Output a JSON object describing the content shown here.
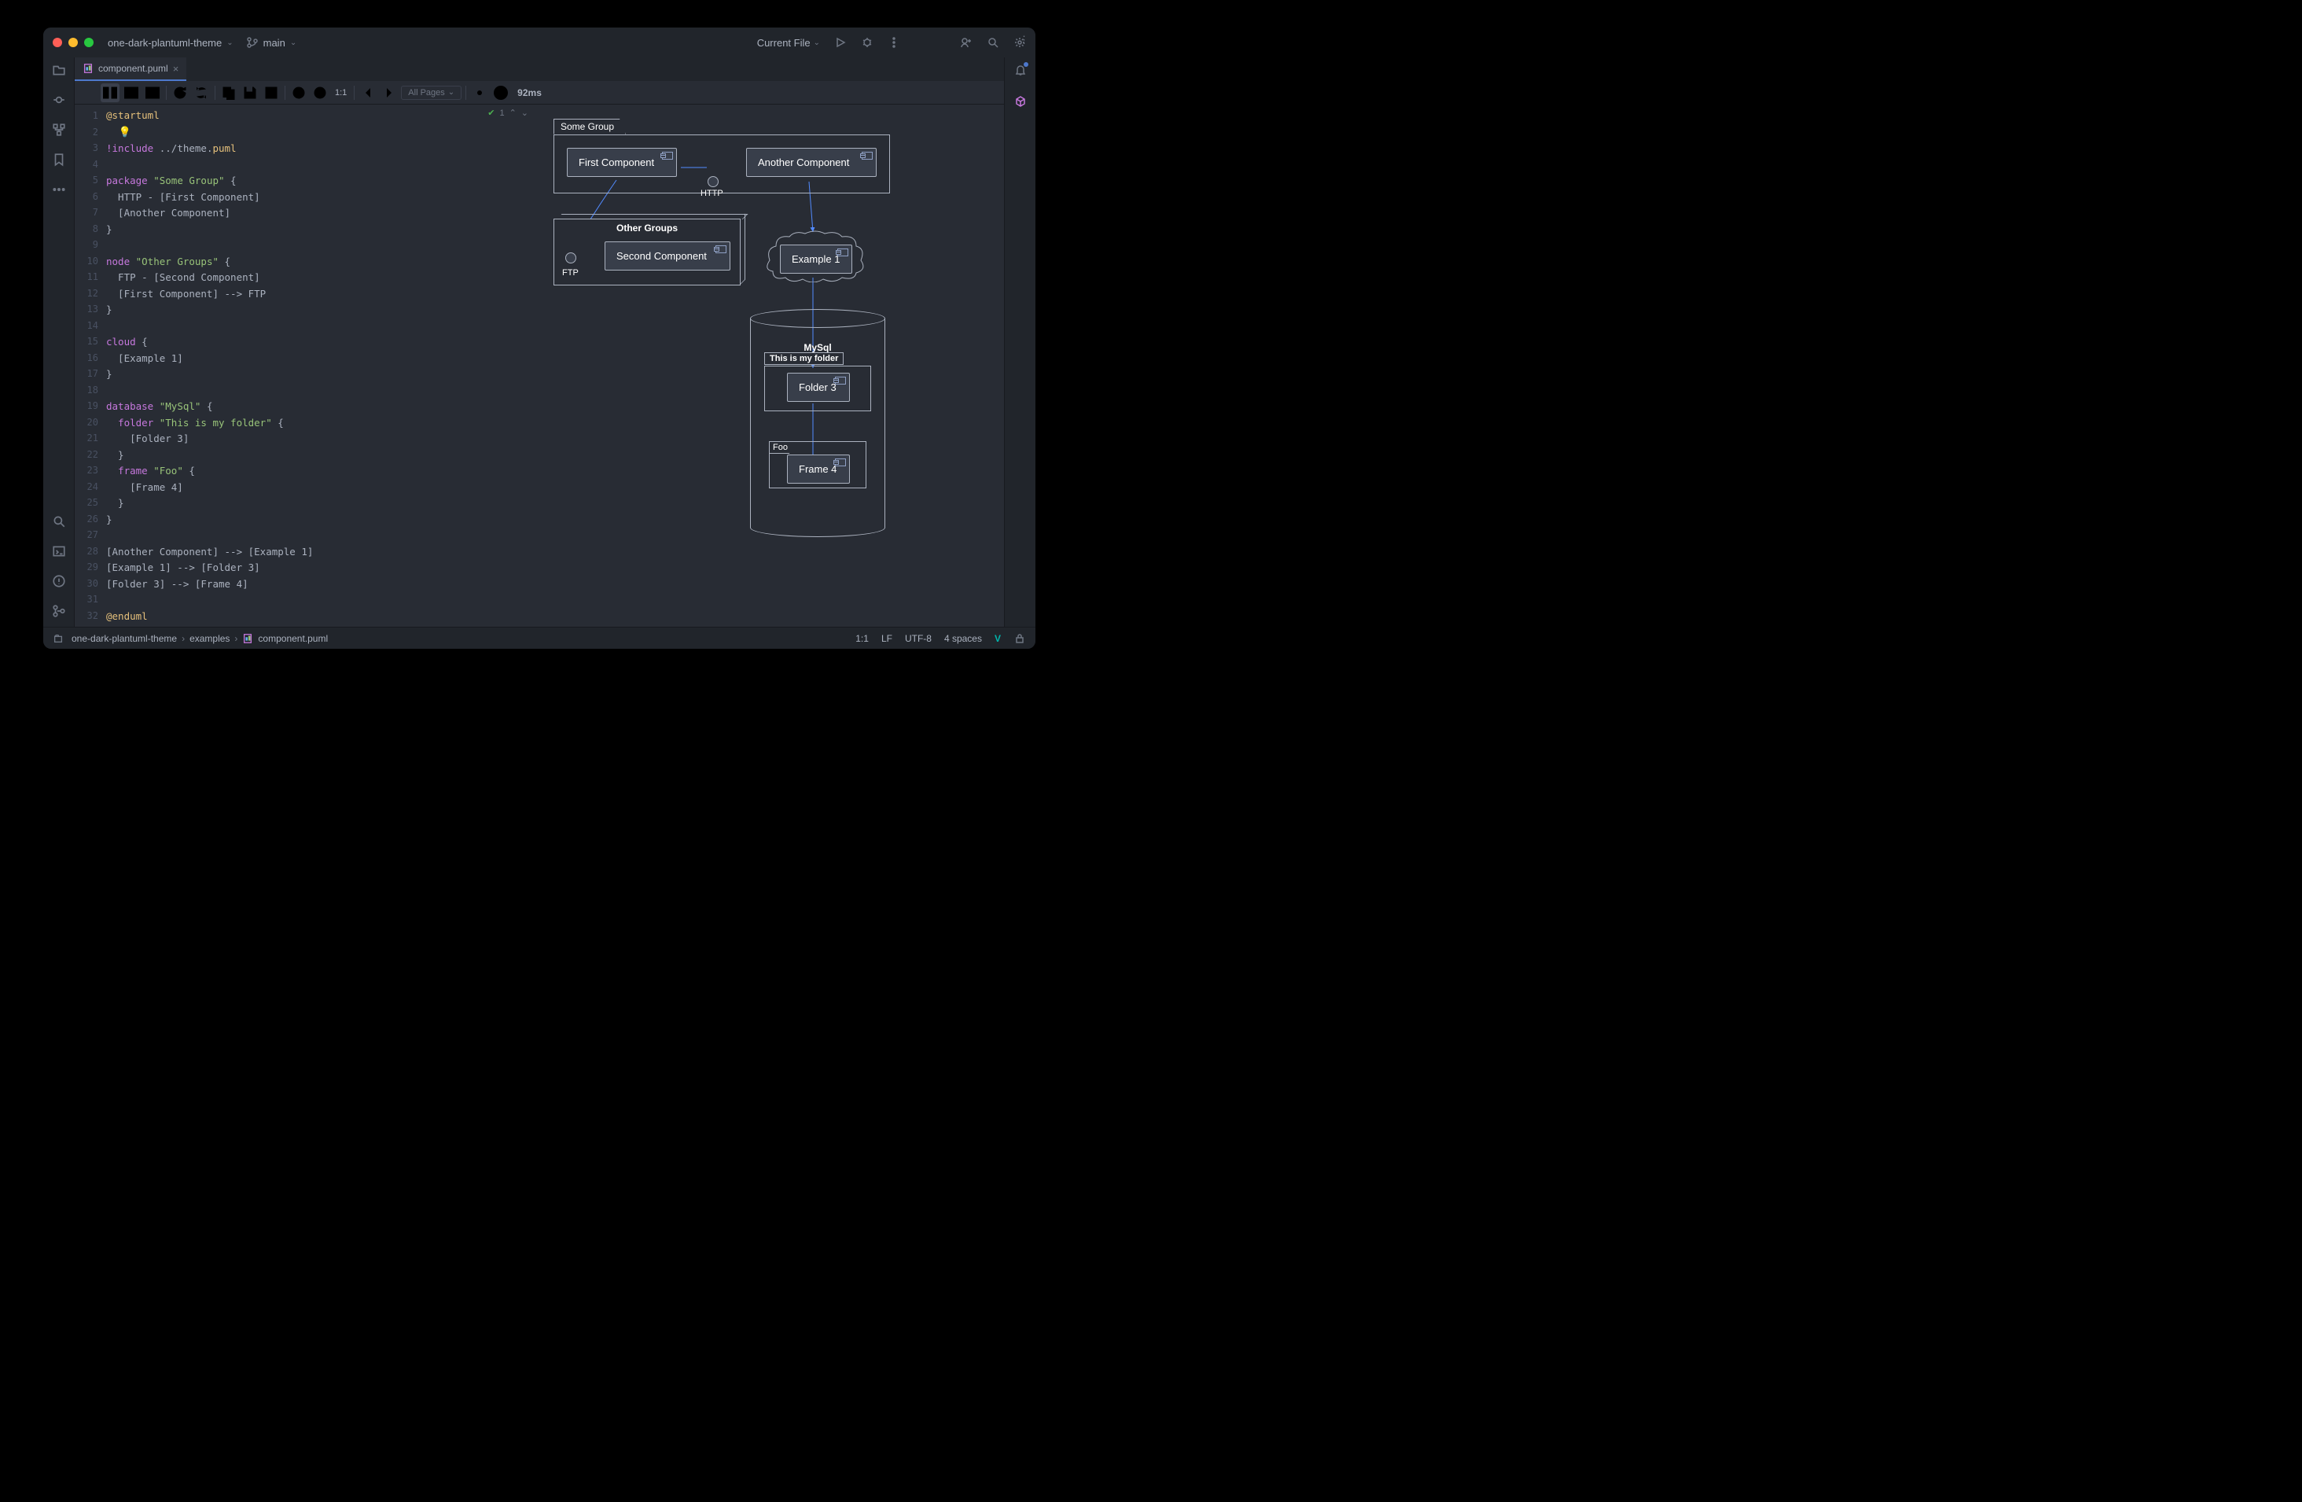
{
  "titlebar": {
    "project": "one-dark-plantuml-theme",
    "branch": "main",
    "run_config": "Current File"
  },
  "tabs": {
    "active": "component.puml"
  },
  "toolbar": {
    "ratio": "1:1",
    "pages": "All Pages",
    "timing": "92ms"
  },
  "inspection": {
    "count": "1"
  },
  "code": {
    "lines": [
      {
        "n": 1,
        "t": "@startuml",
        "cls": "y"
      },
      {
        "n": 2,
        "t": "  💡",
        "cls": "bulb"
      },
      {
        "n": 3,
        "t": "!include ../theme.puml",
        "seg": [
          [
            "k",
            "!include"
          ],
          [
            "p",
            " ../theme."
          ],
          [
            "y",
            "puml"
          ]
        ]
      },
      {
        "n": 4,
        "t": ""
      },
      {
        "n": 5,
        "seg": [
          [
            "k",
            "package"
          ],
          [
            "p",
            " "
          ],
          [
            "s",
            "\"Some Group\""
          ],
          [
            "p",
            " {"
          ]
        ]
      },
      {
        "n": 6,
        "seg": [
          [
            "p",
            "  HTTP - [First Component]"
          ]
        ]
      },
      {
        "n": 7,
        "seg": [
          [
            "p",
            "  [Another Component]"
          ]
        ]
      },
      {
        "n": 8,
        "seg": [
          [
            "p",
            "}"
          ]
        ]
      },
      {
        "n": 9,
        "t": ""
      },
      {
        "n": 10,
        "seg": [
          [
            "k",
            "node"
          ],
          [
            "p",
            " "
          ],
          [
            "s",
            "\"Other Groups\""
          ],
          [
            "p",
            " {"
          ]
        ]
      },
      {
        "n": 11,
        "seg": [
          [
            "p",
            "  FTP - [Second Component]"
          ]
        ]
      },
      {
        "n": 12,
        "seg": [
          [
            "p",
            "  [First Component] --> FTP"
          ]
        ]
      },
      {
        "n": 13,
        "seg": [
          [
            "p",
            "}"
          ]
        ]
      },
      {
        "n": 14,
        "t": ""
      },
      {
        "n": 15,
        "seg": [
          [
            "k",
            "cloud"
          ],
          [
            "p",
            " {"
          ]
        ]
      },
      {
        "n": 16,
        "seg": [
          [
            "p",
            "  [Example 1]"
          ]
        ]
      },
      {
        "n": 17,
        "seg": [
          [
            "p",
            "}"
          ]
        ]
      },
      {
        "n": 18,
        "t": ""
      },
      {
        "n": 19,
        "seg": [
          [
            "k",
            "database"
          ],
          [
            "p",
            " "
          ],
          [
            "s",
            "\"MySql\""
          ],
          [
            "p",
            " {"
          ]
        ]
      },
      {
        "n": 20,
        "seg": [
          [
            "p",
            "  "
          ],
          [
            "k",
            "folder"
          ],
          [
            "p",
            " "
          ],
          [
            "s",
            "\"This is my folder\""
          ],
          [
            "p",
            " {"
          ]
        ]
      },
      {
        "n": 21,
        "seg": [
          [
            "p",
            "    [Folder 3]"
          ]
        ]
      },
      {
        "n": 22,
        "seg": [
          [
            "p",
            "  }"
          ]
        ]
      },
      {
        "n": 23,
        "seg": [
          [
            "p",
            "  "
          ],
          [
            "k",
            "frame"
          ],
          [
            "p",
            " "
          ],
          [
            "s",
            "\"Foo\""
          ],
          [
            "p",
            " {"
          ]
        ]
      },
      {
        "n": 24,
        "seg": [
          [
            "p",
            "    [Frame 4]"
          ]
        ]
      },
      {
        "n": 25,
        "seg": [
          [
            "p",
            "  }"
          ]
        ]
      },
      {
        "n": 26,
        "seg": [
          [
            "p",
            "}"
          ]
        ]
      },
      {
        "n": 27,
        "t": ""
      },
      {
        "n": 28,
        "seg": [
          [
            "p",
            "[Another Component] --> [Example 1]"
          ]
        ]
      },
      {
        "n": 29,
        "seg": [
          [
            "p",
            "[Example 1] --> [Folder 3]"
          ]
        ]
      },
      {
        "n": 30,
        "seg": [
          [
            "p",
            "[Folder 3] --> [Frame 4]"
          ]
        ]
      },
      {
        "n": 31,
        "t": ""
      },
      {
        "n": 32,
        "t": "@enduml",
        "cls": "y"
      }
    ]
  },
  "diagram": {
    "group1": "Some Group",
    "comp1": "First Component",
    "comp2": "Another Component",
    "http": "HTTP",
    "node": "Other Groups",
    "comp3": "Second Component",
    "ftp": "FTP",
    "cloud_comp": "Example 1",
    "db": "MySql",
    "folder": "This is my folder",
    "comp4": "Folder 3",
    "frame": "Foo",
    "comp5": "Frame 4"
  },
  "breadcrumb": {
    "p1": "one-dark-plantuml-theme",
    "p2": "examples",
    "p3": "component.puml"
  },
  "status": {
    "pos": "1:1",
    "eol": "LF",
    "enc": "UTF-8",
    "indent": "4 spaces"
  }
}
